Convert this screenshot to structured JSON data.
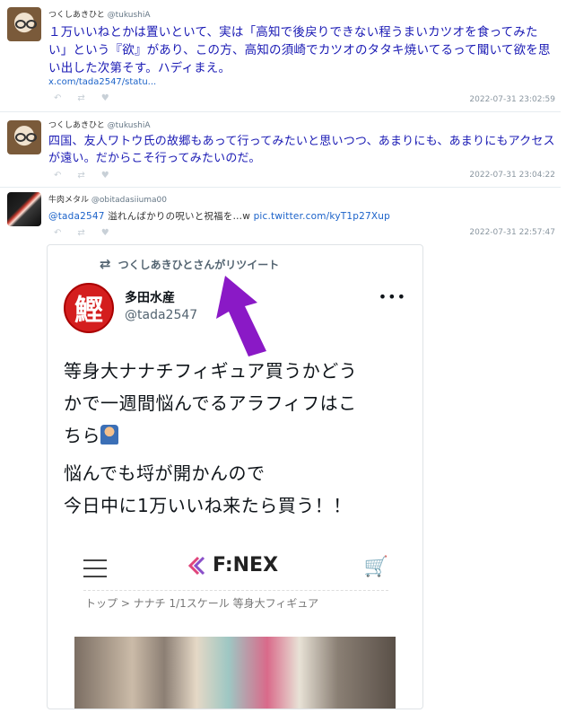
{
  "tweets": [
    {
      "name": "つくしあきひと",
      "handle": "@tukushiA",
      "text": "１万いいねとかは置いといて、実は「高知で後戻りできない程うまいカツオを食ってみたい」という『欲』があり、この方、高知の須崎でカツオのタタキ焼いてるって聞いて欲を思い出した次第そす。ハディまえ。",
      "link": "x.com/tada2547/statu...",
      "timestamp": "2022-07-31 23:02:59"
    },
    {
      "name": "つくしあきひと",
      "handle": "@tukushiA",
      "text": "四国、友人ワトウ氏の故郷もあって行ってみたいと思いつつ、あまりにも、あまりにもアクセスが遠い。だからこそ行ってみたいのだ。",
      "timestamp": "2022-07-31 23:04:22"
    },
    {
      "name": "牛肉メタル",
      "handle": "@obitadasiiuma00",
      "text_mention": "@tada2547",
      "text_plain": " 溢れんばかりの呪いと祝福を…w ",
      "text_link": "pic.twitter.com/kyT1p27Xup",
      "timestamp": "2022-07-31 22:57:47"
    }
  ],
  "actions": {
    "reply": "↶",
    "retweet": "⇄",
    "like": "♥"
  },
  "card": {
    "retweet_label": "つくしあきひとさんがリツイート",
    "avatar_glyph": "鰹",
    "account_name": "多田水産",
    "account_handle": "@tada2547",
    "more": "•••",
    "post_lines": [
      "等身大ナナチフィギュア買うかどう",
      "かで一週間悩んでるアラフィフはこ",
      "ちら",
      "悩んでも埒が開かんので",
      "今日中に1万いいね来たら買う！！"
    ],
    "site_logo": "F:NEX",
    "breadcrumb": "トップ > ナナチ 1/1スケール 等身大フィギュア"
  },
  "colors": {
    "tweet_text": "#1a1ab4",
    "link": "#1b62c9",
    "arrow": "#8a19c6"
  },
  "icons": [
    "retweet-icon",
    "hamburger-icon",
    "cart-icon",
    "arrow-annotation"
  ]
}
